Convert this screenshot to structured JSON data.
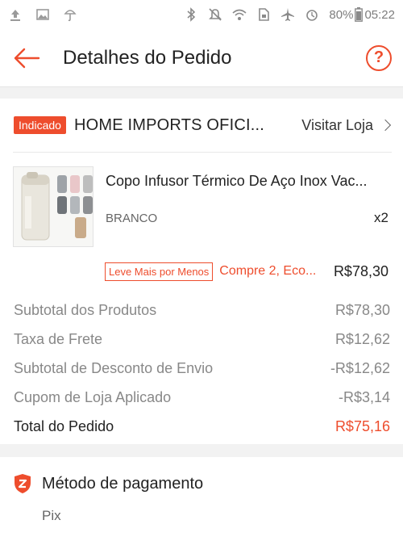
{
  "status_bar": {
    "icons_left": [
      "upload-icon",
      "image-icon",
      "weather-icon"
    ],
    "icons_right": [
      "bluetooth-icon",
      "mute-icon",
      "wifi-icon",
      "sim-icon",
      "airplane-icon",
      "alarm-icon",
      "battery-icon"
    ],
    "battery": "80%",
    "time": "05:22"
  },
  "header": {
    "title": "Detalhes do Pedido",
    "help_symbol": "?"
  },
  "shop": {
    "badge": "Indicado",
    "name": "HOME IMPORTS OFICI...",
    "visit_label": "Visitar Loja"
  },
  "product": {
    "title": "Copo Infusor Térmico De Aço Inox Vac...",
    "variant": "BRANCO",
    "quantity": "x2"
  },
  "promo": {
    "badge": "Leve Mais por Menos",
    "text": "Compre 2, Eco...",
    "price": "R$78,30"
  },
  "summary": [
    {
      "label": "Subtotal dos Produtos",
      "value": "R$78,30"
    },
    {
      "label": "Taxa de Frete",
      "value": "R$12,62"
    },
    {
      "label": "Subtotal de Desconto de Envio",
      "value": "-R$12,62"
    },
    {
      "label": "Cupom de Loja Aplicado",
      "value": "-R$3,14"
    },
    {
      "label": "Total do Pedido",
      "value": "R$75,16"
    }
  ],
  "payment": {
    "title": "Método de pagamento",
    "method": "Pix"
  },
  "colors": {
    "accent": "#ee4d2d",
    "muted_text": "#888888",
    "background": "#f2f2f2"
  }
}
